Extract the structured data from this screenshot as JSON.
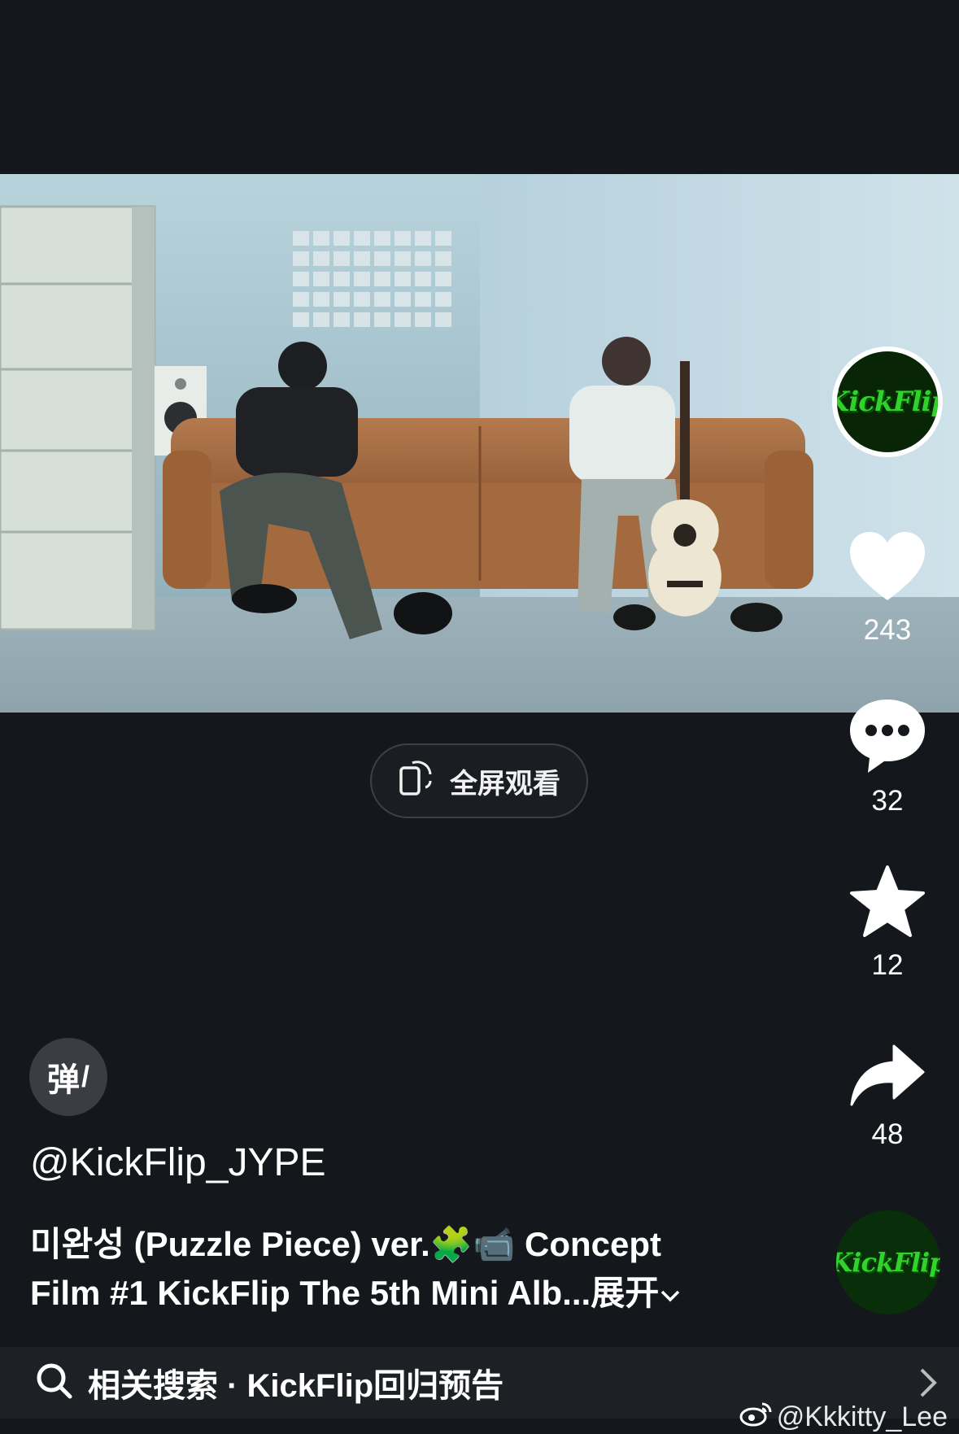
{
  "video": {
    "fullscreen_label": "全屏观看"
  },
  "channel": {
    "logo_text": "KickFlip"
  },
  "actions": {
    "likes": "243",
    "comments": "32",
    "favorites": "12",
    "shares": "48"
  },
  "danmu": {
    "label": "弹"
  },
  "post": {
    "author": "@KickFlip_JYPE",
    "description_line1": "미완성 (Puzzle Piece) ver.🧩📹 Concept",
    "description_line2": "Film #1 KickFlip The 5th Mini Alb...",
    "expand_label": "展开"
  },
  "search": {
    "text": "相关搜索 · KickFlip回归预告"
  },
  "watermark": {
    "text": "@Kkkitty_Lee"
  },
  "colors": {
    "background": "#14171b",
    "logo_green": "#30d22b"
  }
}
